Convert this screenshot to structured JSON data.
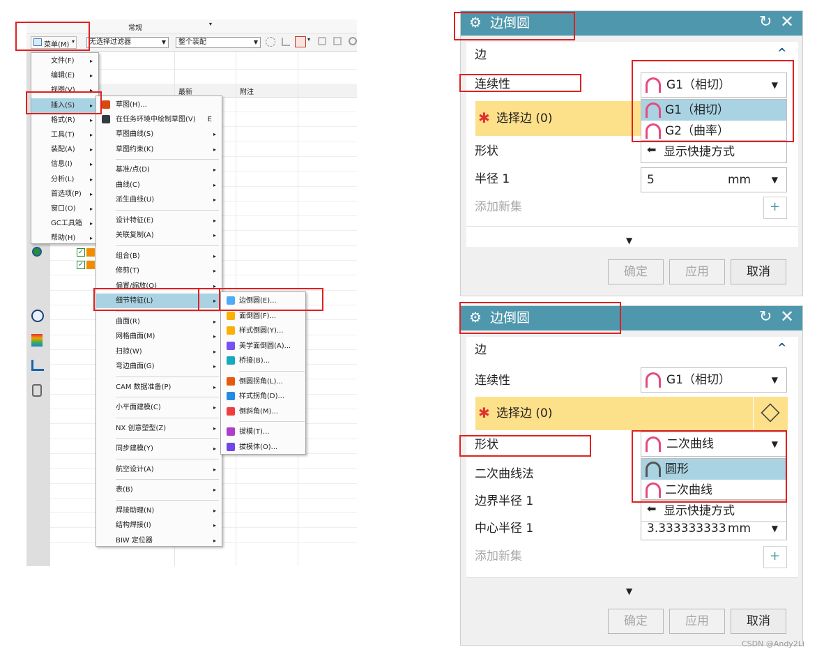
{
  "nx": {
    "top_label": "常规",
    "menu_button": "菜单(M)",
    "filter_combo": "无选择过滤器",
    "assembly_combo": "整个装配",
    "col_latest": "最新",
    "col_note": "附注",
    "main_menu": [
      "文件(F)",
      "编辑(E)",
      "视图(V)",
      "插入(S)",
      "格式(R)",
      "工具(T)",
      "装配(A)",
      "信息(I)",
      "分析(L)",
      "首选项(P)",
      "窗口(O)",
      "GC工具箱",
      "帮助(H)"
    ],
    "insert_menu": {
      "item_sketch": "草图(H)...",
      "item_task_sketch": "在任务环境中绘制草图(V)",
      "item_task_sketch_key": "E",
      "group1": [
        "草图曲线(S)",
        "草图约束(K)"
      ],
      "group2": [
        "基准/点(D)",
        "曲线(C)",
        "派生曲线(U)"
      ],
      "group3": [
        "设计特征(E)",
        "关联复制(A)"
      ],
      "group4": [
        "组合(B)",
        "修剪(T)",
        "偏置/缩放(O)",
        "细节特征(L)"
      ],
      "group5": [
        "曲面(R)",
        "网格曲面(M)",
        "扫掠(W)",
        "弯边曲面(G)"
      ],
      "group6": [
        "CAM 数据准备(P)"
      ],
      "group7": [
        "小平面建模(C)"
      ],
      "group8": [
        "NX 创意塑型(Z)"
      ],
      "group9": [
        "同步建模(Y)"
      ],
      "group10": [
        "航空设计(A)"
      ],
      "group11": [
        "表(B)"
      ],
      "group12": [
        "焊接助理(N)",
        "结构焊接(I)",
        "BIW 定位器"
      ]
    },
    "detail_menu": {
      "group1": [
        "边倒圆(E)...",
        "面倒圆(F)...",
        "样式倒圆(Y)...",
        "美学面倒圆(A)...",
        "桥接(B)..."
      ],
      "group2": [
        "倒圆拐角(L)...",
        "样式拐角(D)...",
        "倒斜角(M)..."
      ],
      "group3": [
        "拔模(T)...",
        "拔模体(O)..."
      ]
    }
  },
  "dialog1": {
    "title": "边倒圆",
    "section": "边",
    "continuity_label": "连续性",
    "continuity_value": "G1（相切）",
    "select_edge_label": "选择边 (0)",
    "shape_label": "形状",
    "dropdown_options": [
      "G1（相切）",
      "G2（曲率）"
    ],
    "shortcut": "显示快捷方式",
    "radius_label": "半径 1",
    "radius_value": "5",
    "radius_unit": "mm",
    "add_set": "添加新集",
    "ok": "确定",
    "apply": "应用",
    "cancel": "取消"
  },
  "dialog2": {
    "title": "边倒圆",
    "section": "边",
    "continuity_label": "连续性",
    "continuity_value": "G1（相切）",
    "select_edge_label": "选择边 (0)",
    "shape_label": "形状",
    "shape_value": "二次曲线",
    "dropdown_options": [
      "圆形",
      "二次曲线"
    ],
    "shortcut": "显示快捷方式",
    "conic_method_label": "二次曲线法",
    "boundary_radius_label": "边界半径 1",
    "center_radius_label": "中心半径 1",
    "center_radius_value": "3.333333333",
    "center_radius_unit": "mm",
    "add_set": "添加新集",
    "ok": "确定",
    "apply": "应用",
    "cancel": "取消"
  },
  "watermark": "CSDN @Andy2Li",
  "colors": {
    "header": "#4e97ac",
    "highlight": "#a9d3e2",
    "required_band": "#fde08a",
    "annotation": "#e02020"
  }
}
